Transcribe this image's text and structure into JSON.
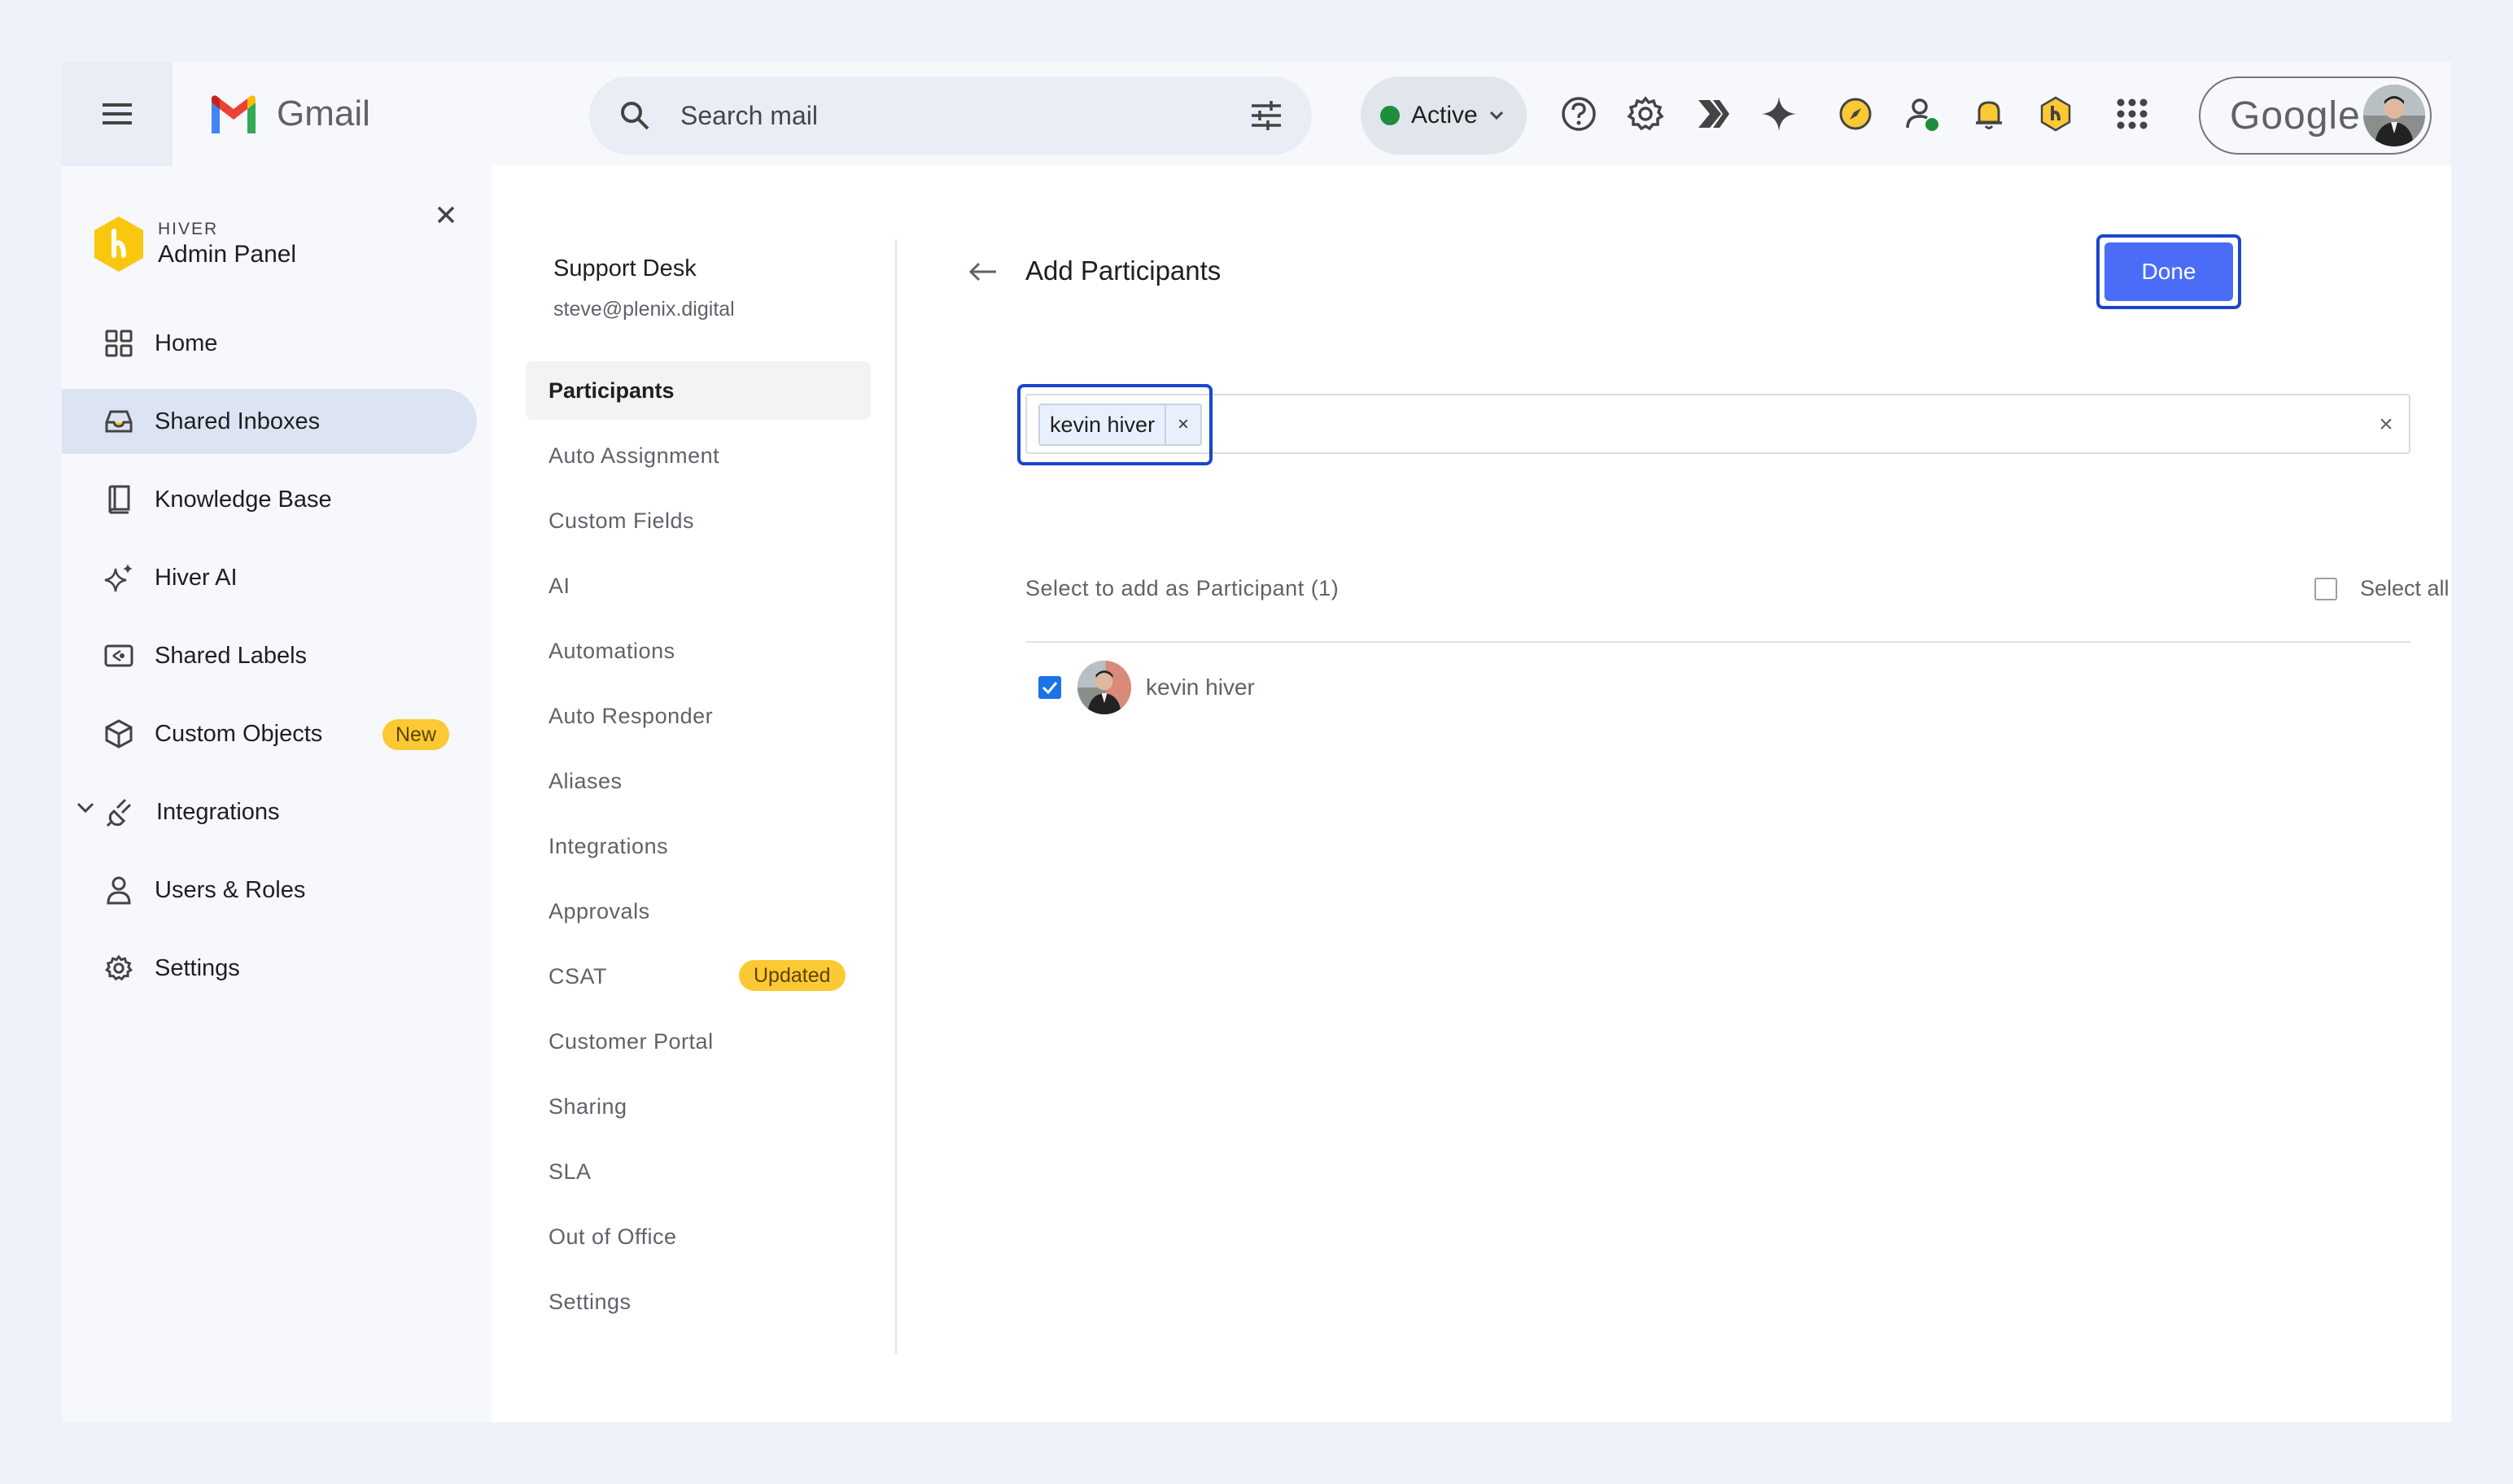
{
  "topbar": {
    "app_name": "Gmail",
    "search_placeholder": "Search mail",
    "status_label": "Active",
    "status_color": "#1e8e3e",
    "icons": [
      "help-icon",
      "settings-gear-icon",
      "hiver-switch-icon",
      "gemini-sparkle-icon",
      "compass-icon",
      "contact-status-icon",
      "notification-bell-icon",
      "hiver-logo-icon",
      "apps-grid-icon"
    ],
    "account_brand": "Google"
  },
  "sidebar": {
    "brand_small": "HIVER",
    "brand_title": "Admin Panel",
    "items": [
      {
        "label": "Home",
        "icon": "grid-icon"
      },
      {
        "label": "Shared Inboxes",
        "icon": "inbox-icon",
        "active": true
      },
      {
        "label": "Knowledge Base",
        "icon": "book-icon"
      },
      {
        "label": "Hiver AI",
        "icon": "sparkles-icon"
      },
      {
        "label": "Shared Labels",
        "icon": "label-icon"
      },
      {
        "label": "Custom Objects",
        "icon": "cube-icon",
        "badge": "New"
      },
      {
        "label": "Integrations",
        "icon": "plug-icon",
        "expandable": true
      },
      {
        "label": "Users & Roles",
        "icon": "user-icon"
      },
      {
        "label": "Settings",
        "icon": "gear-icon"
      }
    ]
  },
  "subnav": {
    "title": "Support Desk",
    "email": "steve@plenix.digital",
    "items": [
      {
        "label": "Participants",
        "active": true
      },
      {
        "label": "Auto Assignment"
      },
      {
        "label": "Custom Fields"
      },
      {
        "label": "AI"
      },
      {
        "label": "Automations"
      },
      {
        "label": "Auto Responder"
      },
      {
        "label": "Aliases"
      },
      {
        "label": "Integrations"
      },
      {
        "label": "Approvals"
      },
      {
        "label": "CSAT",
        "badge": "Updated"
      },
      {
        "label": "Customer Portal"
      },
      {
        "label": "Sharing"
      },
      {
        "label": "SLA"
      },
      {
        "label": "Out of Office"
      },
      {
        "label": "Settings"
      }
    ]
  },
  "content": {
    "title": "Add Participants",
    "done_label": "Done",
    "chip_label": "kevin hiver",
    "chip_remove": "×",
    "clear_label": "×",
    "select_label": "Select to add as Participant (1)",
    "select_all_label": "Select all",
    "participants": [
      {
        "name": "kevin hiver",
        "checked": true
      }
    ],
    "accent_color": "#4a6cf7"
  }
}
